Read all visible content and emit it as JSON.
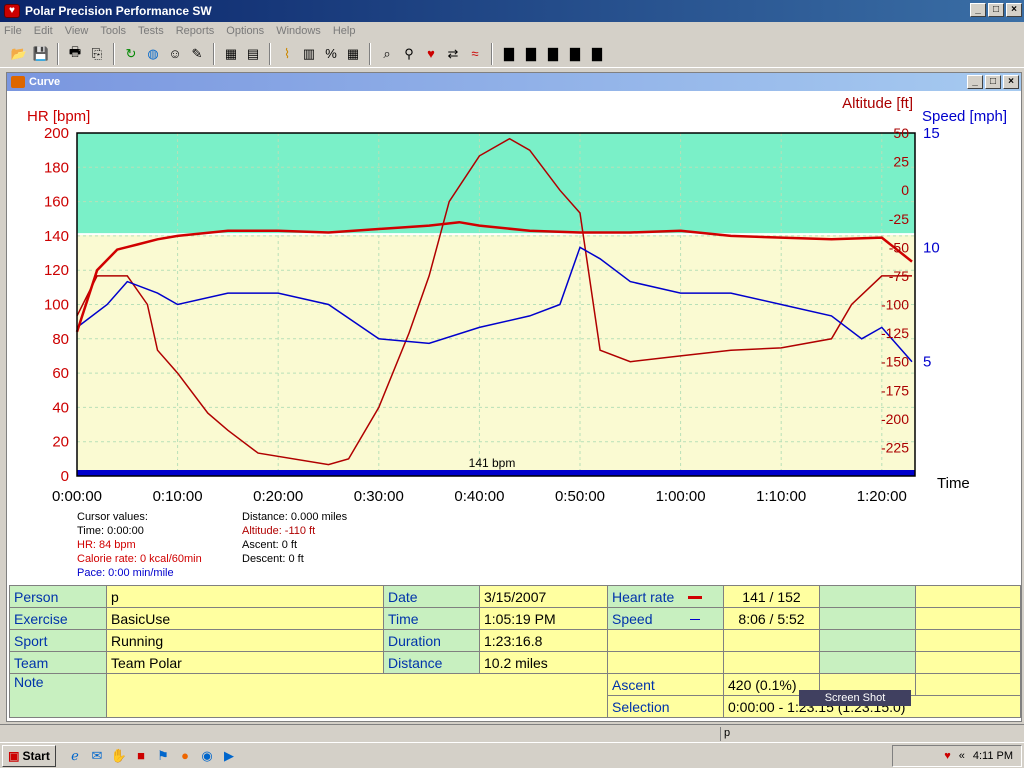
{
  "app": {
    "title": "Polar Precision Performance SW"
  },
  "menu": [
    "File",
    "Edit",
    "View",
    "Tools",
    "Tests",
    "Reports",
    "Options",
    "Windows",
    "Help"
  ],
  "toolbar_icons": [
    "open-icon",
    "save-icon",
    "print-icon",
    "copy-icon",
    "refresh-icon",
    "globe-icon",
    "person-icon",
    "tool-icon",
    "calendar-icon",
    "book-icon",
    "curve-icon",
    "bar-icon",
    "percent-icon",
    "table-icon",
    "zoom-icon",
    "chart-person-icon",
    "chart-heart-icon",
    "arrows-icon",
    "compare-icon",
    "report1-icon",
    "report2-icon",
    "report3-icon",
    "report4-icon",
    "report5-icon"
  ],
  "child": {
    "title": "Curve"
  },
  "chart_data": {
    "type": "line",
    "ylabel_left": "HR [bpm]",
    "ylabel_right1": "Altitude [ft]",
    "ylabel_right2": "Speed [mph]",
    "xlabel": "Time",
    "hr_ticks": [
      "200",
      "180",
      "160",
      "140",
      "120",
      "100",
      "80",
      "60",
      "40",
      "20",
      "0"
    ],
    "alt_ticks": [
      "50",
      "25",
      "0",
      "-25",
      "-50",
      "-75",
      "-100",
      "-125",
      "-150",
      "-175",
      "-200",
      "-225"
    ],
    "speed_ticks": [
      "15",
      "10",
      "5"
    ],
    "x_ticks": [
      "0:00:00",
      "0:10:00",
      "0:20:00",
      "0:30:00",
      "0:40:00",
      "0:50:00",
      "1:00:00",
      "1:10:00",
      "1:20:00"
    ],
    "hr_limit_label": "141 bpm",
    "hr_ylim": [
      0,
      200
    ],
    "alt_ylim": [
      -250,
      50
    ],
    "speed_ylim": [
      0,
      15
    ],
    "x_minutes_max": 83.3,
    "hr_limit": 141,
    "hr": {
      "name": "HR",
      "x": [
        0,
        2,
        4,
        6,
        8,
        10,
        15,
        20,
        25,
        30,
        35,
        38,
        40,
        45,
        50,
        55,
        60,
        65,
        70,
        75,
        80,
        83
      ],
      "y": [
        84,
        120,
        132,
        135,
        138,
        140,
        143,
        143,
        142,
        144,
        146,
        148,
        146,
        143,
        142,
        142,
        143,
        140,
        139,
        138,
        139,
        125
      ]
    },
    "altitude": {
      "name": "Altitude",
      "x": [
        0,
        2,
        5,
        7,
        8,
        10,
        13,
        15,
        18,
        25,
        27,
        30,
        33,
        35,
        37,
        40,
        43,
        45,
        48,
        50,
        52,
        55,
        60,
        65,
        70,
        75,
        77,
        80,
        83
      ],
      "y": [
        -110,
        -75,
        -75,
        -100,
        -140,
        -160,
        -195,
        -210,
        -230,
        -240,
        -235,
        -190,
        -125,
        -75,
        -10,
        30,
        45,
        35,
        0,
        -20,
        -140,
        -150,
        -145,
        -140,
        -138,
        -130,
        -100,
        -75,
        -75
      ]
    },
    "speed": {
      "name": "Speed",
      "x": [
        0,
        3,
        5,
        8,
        10,
        15,
        20,
        25,
        30,
        35,
        40,
        45,
        48,
        50,
        52,
        55,
        60,
        65,
        70,
        75,
        78,
        80,
        83
      ],
      "y": [
        6.5,
        7.5,
        8.5,
        8,
        7.5,
        8,
        8,
        7.5,
        6,
        5.8,
        6.5,
        7,
        7.5,
        10,
        9.5,
        8.5,
        8,
        8,
        7.5,
        7,
        6,
        6.5,
        5
      ]
    }
  },
  "cursor": {
    "header": "Cursor values:",
    "time": "Time: 0:00:00",
    "hr": "HR: 84 bpm",
    "calorie": "Calorie rate: 0 kcal/60min",
    "pace": "Pace: 0:00 min/mile",
    "distance": "Distance: 0.000 miles",
    "altitude": "Altitude: -110 ft",
    "ascent": "Ascent: 0 ft",
    "descent": "Descent: 0 ft"
  },
  "info": {
    "person_label": "Person",
    "person": "p",
    "exercise_label": "Exercise",
    "exercise": "BasicUse",
    "sport_label": "Sport",
    "sport": "Running",
    "team_label": "Team",
    "team": "Team Polar",
    "note_label": "Note",
    "date_label": "Date",
    "date": "3/15/2007",
    "time_label": "Time",
    "time": "1:05:19 PM",
    "duration_label": "Duration",
    "duration": "1:23:16.8",
    "distance_label": "Distance",
    "distance": "10.2 miles",
    "hr_label": "Heart rate",
    "hr": "141 / 152",
    "speed_label": "Speed",
    "speed": "8:06 / 5:52",
    "ascent_label": "Ascent",
    "ascent": "420 (0.1%)",
    "selection_label": "Selection",
    "selection": "0:00:00 - 1:23:15 (1:23:15.0)"
  },
  "tooltip": "Screen Shot",
  "status": {
    "cell": "p"
  },
  "taskbar": {
    "start": "Start",
    "clock": "4:11 PM"
  },
  "colors": {
    "hr": "#d00000",
    "altitude": "#b00000",
    "speed": "#0000cc",
    "above_zone": "#7af0c8",
    "below_zone": "#fafad2"
  }
}
